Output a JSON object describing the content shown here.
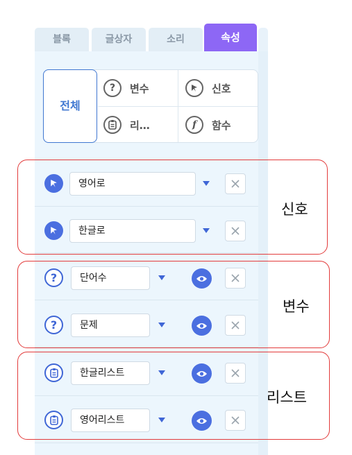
{
  "tabs": [
    {
      "label": "블록",
      "active": false
    },
    {
      "label": "글상자",
      "active": false
    },
    {
      "label": "소리",
      "active": false
    },
    {
      "label": "속성",
      "active": true
    }
  ],
  "filter": {
    "all": "전체",
    "variable": "변수",
    "signal": "신호",
    "list": "리…",
    "function": "함수"
  },
  "signals": [
    {
      "name": "영어로"
    },
    {
      "name": "한글로"
    }
  ],
  "variables": [
    {
      "name": "단어수"
    },
    {
      "name": "문제"
    }
  ],
  "lists": [
    {
      "name": "한글리스트"
    },
    {
      "name": "영어리스트"
    }
  ],
  "annotations": {
    "signal": "신호",
    "variable": "변수",
    "list": "리스트"
  },
  "colors": {
    "active_tab": "#8d67f5",
    "accent_blue": "#4b6fe0",
    "panel_bg": "#ecf6fd",
    "annotation_red": "#e23b3b"
  }
}
